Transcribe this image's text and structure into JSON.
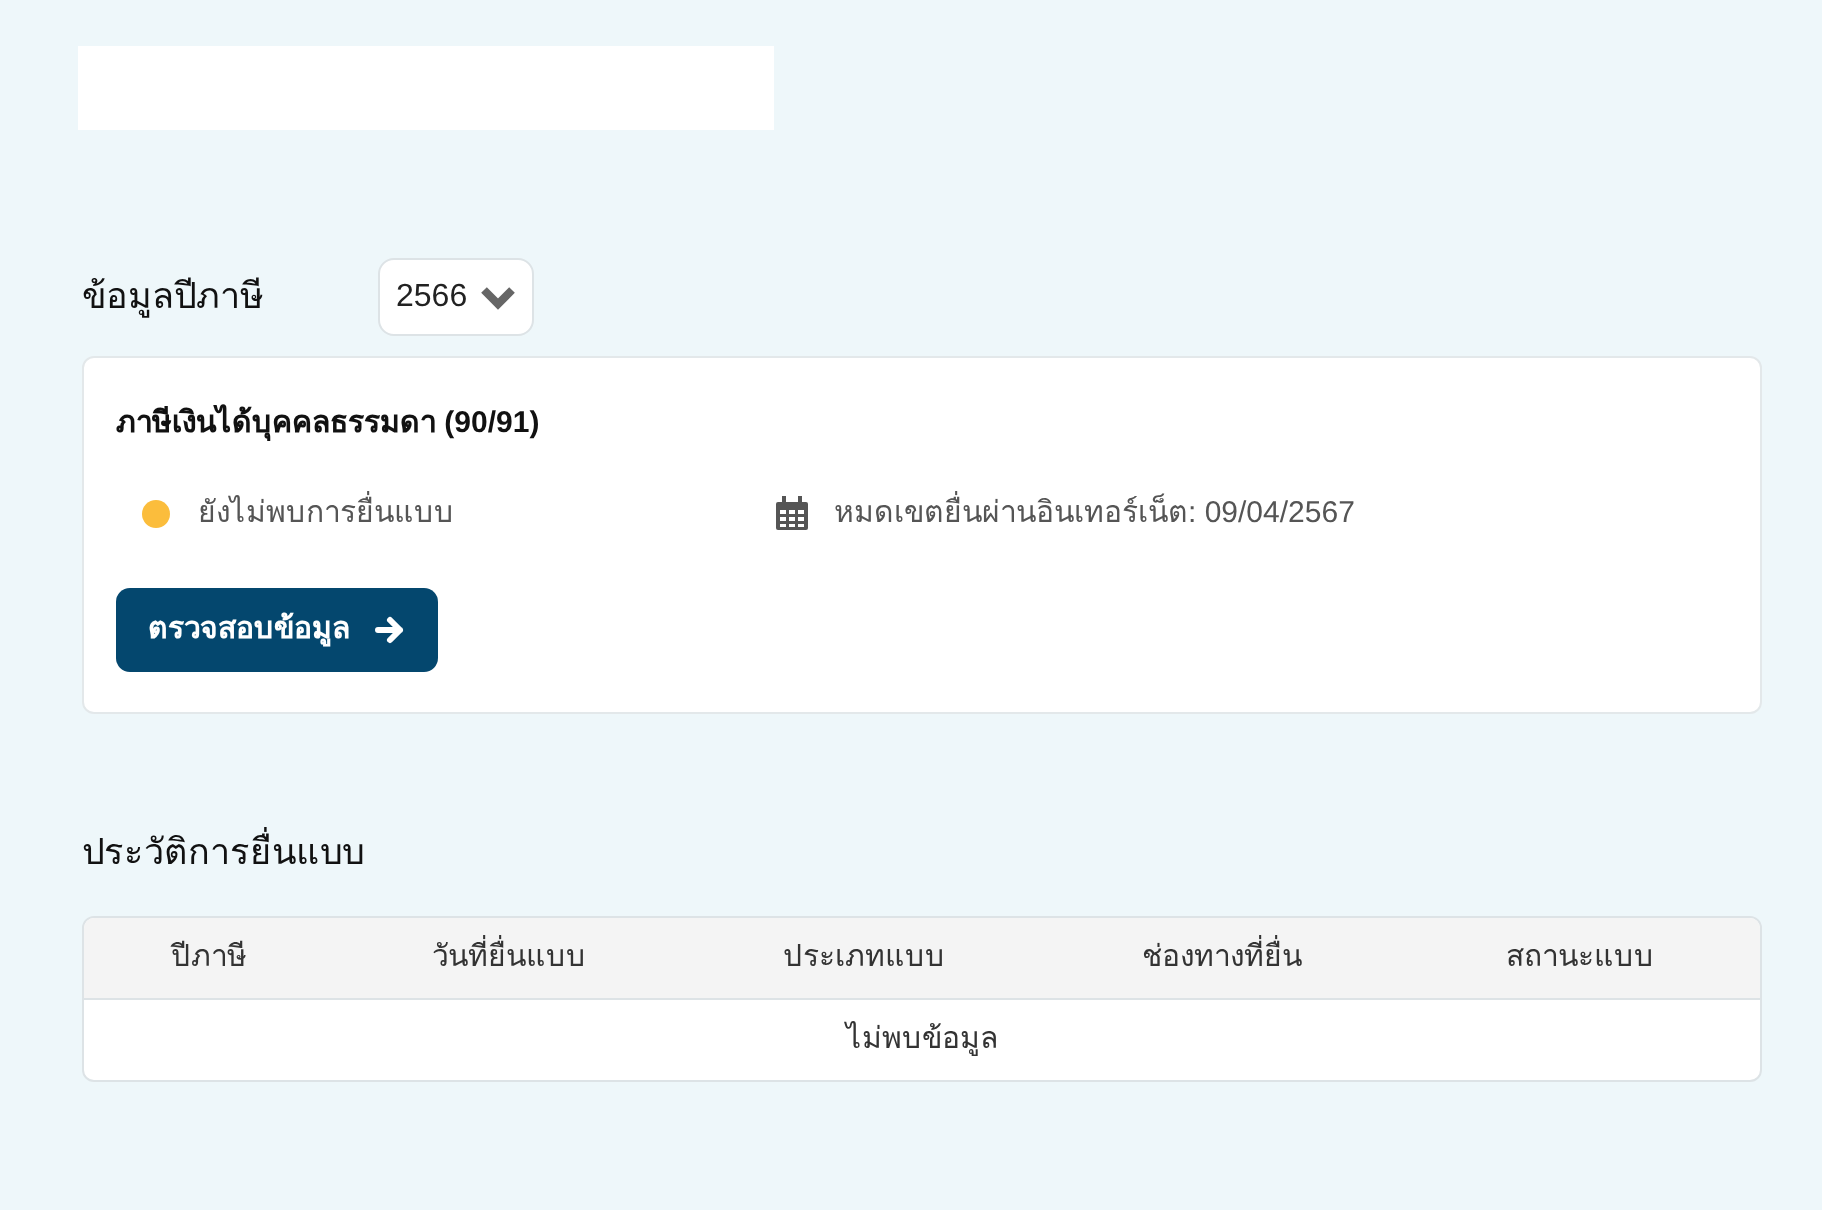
{
  "tax_year": {
    "label": "ข้อมูลปีภาษี",
    "value": "2566"
  },
  "card": {
    "title": "ภาษีเงินได้บุคคลธรรมดา (90/91)",
    "status": {
      "text": "ยังไม่พบการยื่นแบบ",
      "color": "#fbbd3c"
    },
    "deadline": "หมดเขตยื่นผ่านอินเทอร์เน็ต: 09/04/2567",
    "button": "ตรวจสอบข้อมูล"
  },
  "history": {
    "title": "ประวัติการยื่นแบบ",
    "columns": [
      "ปีภาษี",
      "วันที่ยื่นแบบ",
      "ประเภทแบบ",
      "ช่องทางที่ยื่น",
      "สถานะแบบ"
    ],
    "empty_text": "ไม่พบข้อมูล"
  }
}
